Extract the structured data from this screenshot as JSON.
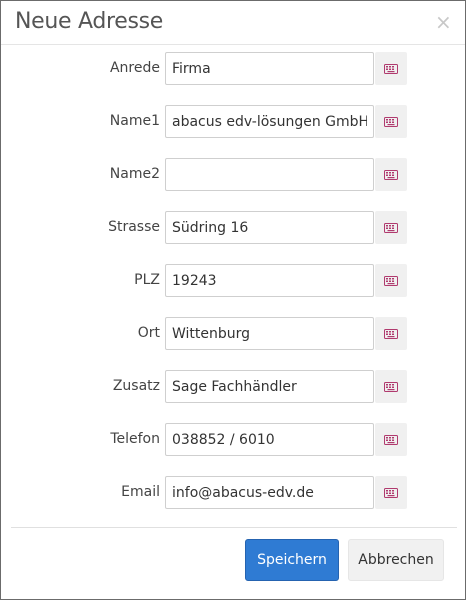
{
  "dialog": {
    "title": "Neue Adresse",
    "close_symbol": "×"
  },
  "fields": [
    {
      "label": "Anrede",
      "value": "Firma",
      "icon": "keyboard-icon"
    },
    {
      "label": "Name1",
      "value": "abacus edv-lösungen GmbH",
      "icon": "keyboard-icon"
    },
    {
      "label": "Name2",
      "value": "",
      "icon": "keyboard-icon"
    },
    {
      "label": "Strasse",
      "value": "Südring 16",
      "icon": "keyboard-icon"
    },
    {
      "label": "PLZ",
      "value": "19243",
      "icon": "keyboard-icon"
    },
    {
      "label": "Ort",
      "value": "Wittenburg",
      "icon": "keyboard-icon"
    },
    {
      "label": "Zusatz",
      "value": "Sage Fachhändler",
      "icon": "keyboard-icon"
    },
    {
      "label": "Telefon",
      "value": "038852 / 6010",
      "icon": "keyboard-icon"
    },
    {
      "label": "Email",
      "value": "info@abacus-edv.de",
      "icon": "keyboard-icon"
    }
  ],
  "buttons": {
    "save_label": "Speichern",
    "cancel_label": "Abbrechen"
  },
  "colors": {
    "primary": "#2f7bd3",
    "icon_color": "#b03a6e"
  }
}
